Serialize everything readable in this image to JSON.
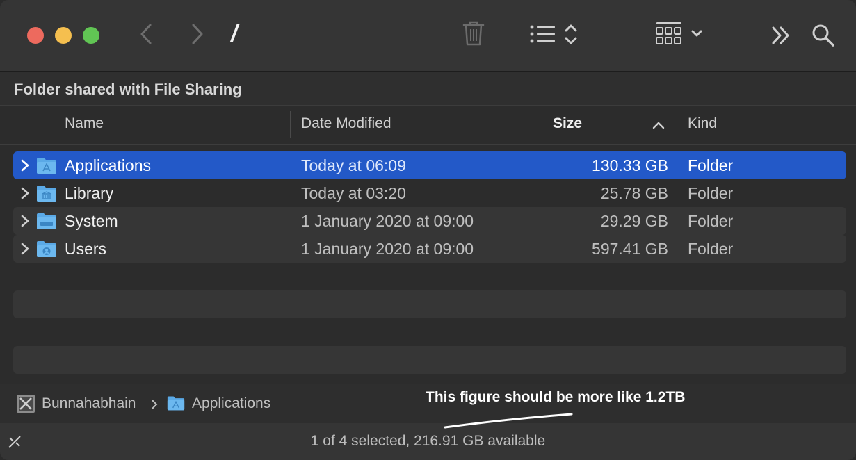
{
  "window": {
    "title": "/",
    "section_title": "Folder shared with File Sharing"
  },
  "icons": {
    "back": "chevron-left-icon",
    "forward": "chevron-right-icon",
    "trash": "trash-icon",
    "list_view": "list-view-icon",
    "group": "grid-group-icon",
    "more": "double-chevron-right-icon",
    "search": "search-icon"
  },
  "columns": {
    "name": "Name",
    "date": "Date Modified",
    "size": "Size",
    "kind": "Kind"
  },
  "rows": [
    {
      "name": "Applications",
      "date": "Today at 06:09",
      "size": "130.33 GB",
      "kind": "Folder",
      "selected": true
    },
    {
      "name": "Library",
      "date": "Today at 03:20",
      "size": "25.78 GB",
      "kind": "Folder",
      "selected": false
    },
    {
      "name": "System",
      "date": "1 January 2020 at 09:00",
      "size": "29.29 GB",
      "kind": "Folder",
      "selected": false
    },
    {
      "name": "Users",
      "date": "1 January 2020 at 09:00",
      "size": "597.41 GB",
      "kind": "Folder",
      "selected": false
    }
  ],
  "pathbar": {
    "disk": "Bunnahabhain",
    "folder": "Applications"
  },
  "status": {
    "text": "1 of 4 selected, 216.91 GB available"
  },
  "annotation": {
    "text": "This figure should be more like 1.2TB"
  },
  "colors": {
    "selection": "#2359c8",
    "close": "#ed6a5e",
    "minimize": "#f5bf4f",
    "maximize": "#61c554",
    "folder": "#5aa9e6"
  }
}
